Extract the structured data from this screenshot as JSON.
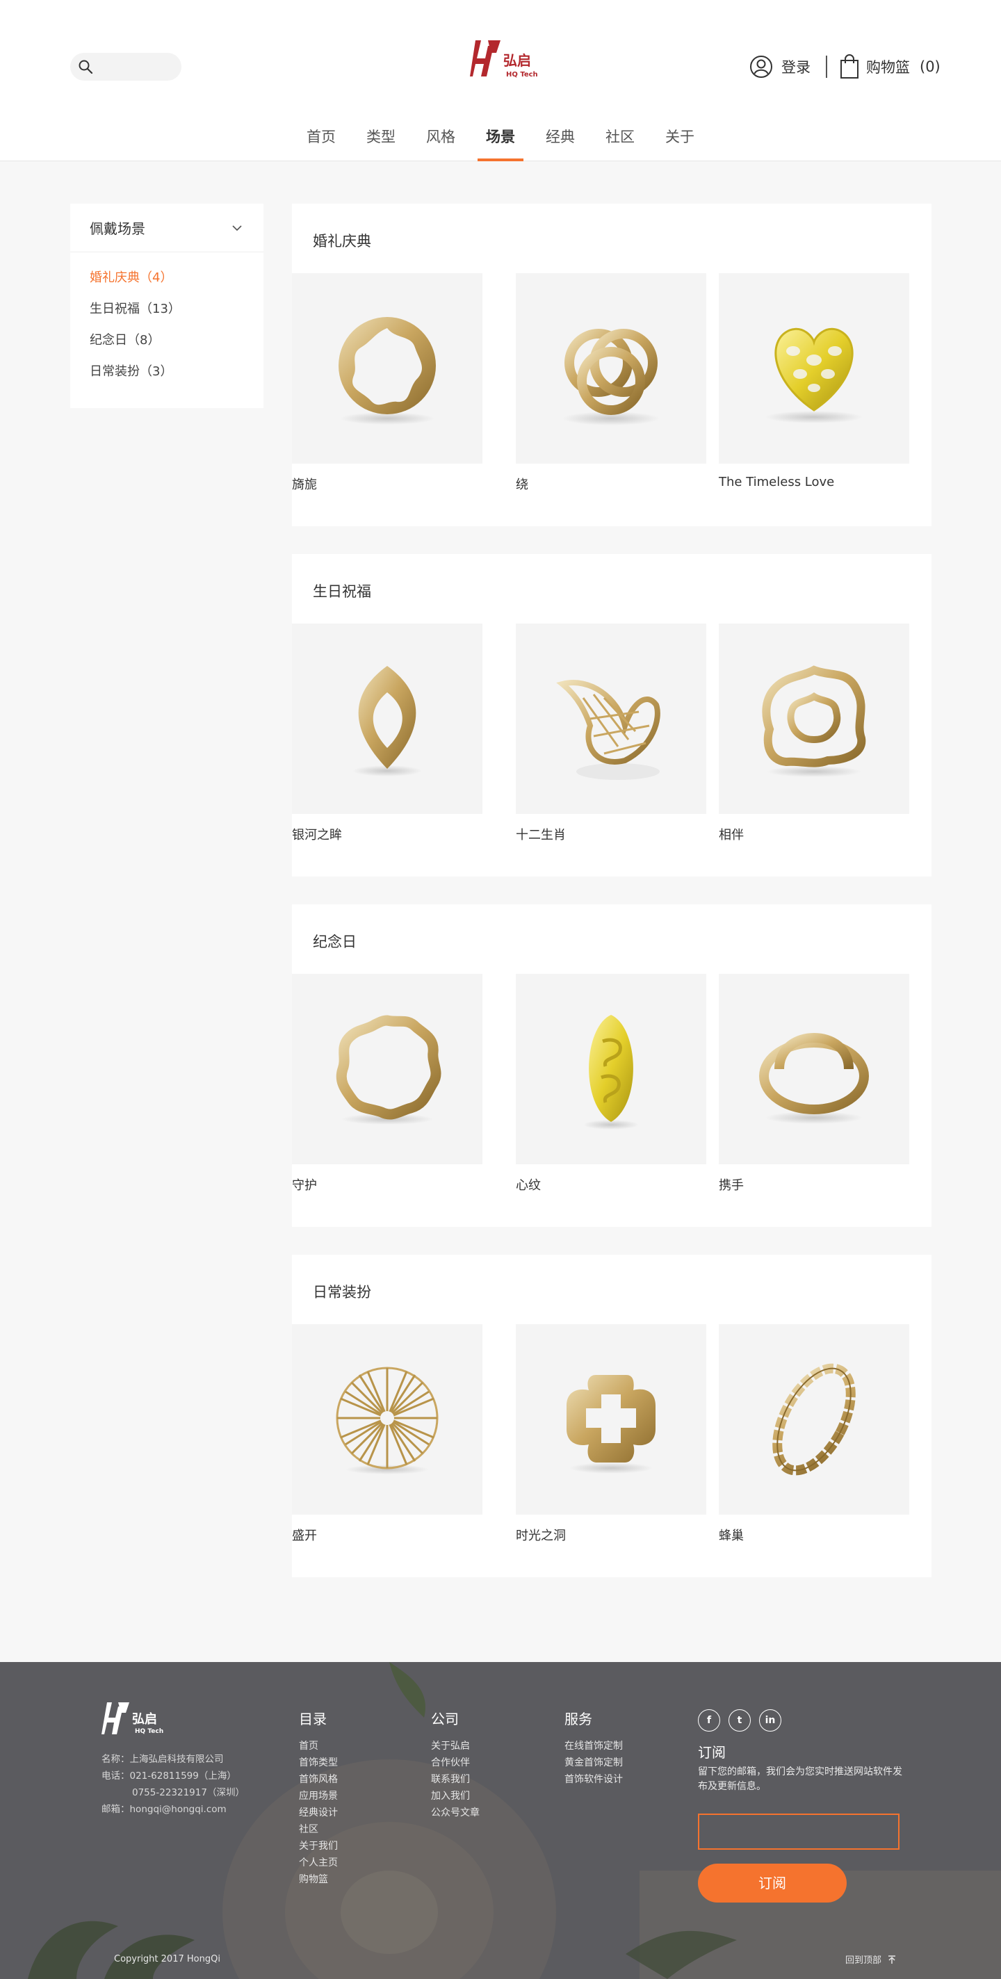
{
  "brand": {
    "name": "弘启",
    "sub": "HQ Tech",
    "accent": "#f5732e",
    "logo_red": "#b3282d"
  },
  "search": {
    "placeholder": ""
  },
  "user": {
    "login": "登录",
    "cart": "购物篮",
    "cart_count": "(0)"
  },
  "nav": [
    {
      "label": "首页",
      "active": false
    },
    {
      "label": "类型",
      "active": false
    },
    {
      "label": "风格",
      "active": false
    },
    {
      "label": "场景",
      "active": true
    },
    {
      "label": "经典",
      "active": false
    },
    {
      "label": "社区",
      "active": false
    },
    {
      "label": "关于",
      "active": false
    }
  ],
  "sidebar": {
    "title": "佩戴场景",
    "items": [
      {
        "label": "婚礼庆典（4）",
        "active": true
      },
      {
        "label": "生日祝福（13）",
        "active": false
      },
      {
        "label": "纪念日（8）",
        "active": false
      },
      {
        "label": "日常装扮（3）",
        "active": false
      }
    ]
  },
  "sections": [
    {
      "title": "婚礼庆典",
      "products": [
        {
          "name": "绕",
          "icon": "knot-ring-icon"
        },
        {
          "name": "The Timeless Love",
          "icon": "heart-lattice-ring-icon"
        },
        {
          "name": "旖旎",
          "icon": "flower-cutout-ring-icon"
        }
      ]
    },
    {
      "title": "生日祝福",
      "products": [
        {
          "name": "十二生肖",
          "icon": "bird-ring-icon"
        },
        {
          "name": "相伴",
          "icon": "wavy-double-ring-icon"
        },
        {
          "name": "银河之眸",
          "icon": "eye-ring-icon"
        }
      ]
    },
    {
      "title": "纪念日",
      "products": [
        {
          "name": "心纹",
          "icon": "carved-bead-icon"
        },
        {
          "name": "携手",
          "icon": "twisted-ring-icon"
        },
        {
          "name": "守护",
          "icon": "wavy-ring-icon"
        }
      ]
    },
    {
      "title": "日常装扮",
      "products": [
        {
          "name": "时光之洞",
          "icon": "cross-ring-icon"
        },
        {
          "name": "蜂巢",
          "icon": "beaded-bracelet-icon"
        },
        {
          "name": "盛开",
          "icon": "starburst-pendant-icon"
        }
      ]
    }
  ],
  "footer": {
    "company": {
      "name": "名称：上海弘启科技有限公司",
      "phone1": "电话：021-62811599（上海）",
      "phone2": "0755-22321917（深圳）",
      "email": "邮箱：hongqi@hongqi.com"
    },
    "catalog": {
      "title": "目录",
      "items": [
        "首页",
        "首饰类型",
        "首饰风格",
        "应用场景",
        "经典设计",
        "社区",
        "关于我们",
        "个人主页",
        "购物篮"
      ]
    },
    "company_col": {
      "title": "公司",
      "items": [
        "关于弘启",
        "合作伙伴",
        "联系我们",
        "加入我们",
        "公众号文章"
      ]
    },
    "service": {
      "title": "服务",
      "items": [
        "在线首饰定制",
        "黄金首饰定制",
        "首饰软件设计"
      ]
    },
    "social": [
      "f",
      "t",
      "in"
    ],
    "subscribe": {
      "title": "订阅",
      "desc": "留下您的邮箱，我们会为您实时推送网站软件发布及更新信息。",
      "placeholder": "",
      "button": "订阅"
    },
    "copyright": "Copyright 2017 HongQi",
    "back_to_top": "回到顶部"
  }
}
